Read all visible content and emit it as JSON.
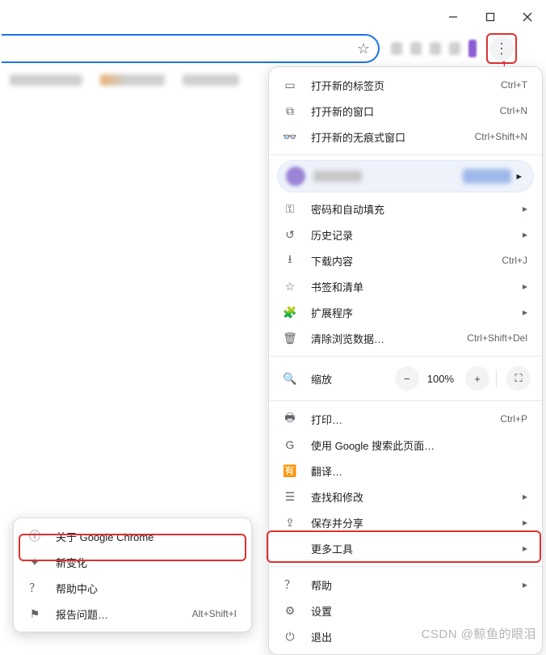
{
  "window_controls": {
    "minimize": "—",
    "maximize": "❐",
    "close": "✕"
  },
  "annotation": {
    "one": "1"
  },
  "menu": {
    "new_tab": {
      "label": "打开新的标签页",
      "shortcut": "Ctrl+T"
    },
    "new_window": {
      "label": "打开新的窗口",
      "shortcut": "Ctrl+N"
    },
    "incognito": {
      "label": "打开新的无痕式窗口",
      "shortcut": "Ctrl+Shift+N"
    },
    "passwords": {
      "label": "密码和自动填充"
    },
    "history": {
      "label": "历史记录"
    },
    "downloads": {
      "label": "下载内容",
      "shortcut": "Ctrl+J"
    },
    "bookmarks": {
      "label": "书签和清单"
    },
    "extensions": {
      "label": "扩展程序"
    },
    "clear_data": {
      "label": "清除浏览数据…",
      "shortcut": "Ctrl+Shift+Del"
    },
    "zoom": {
      "label": "缩放",
      "percent": "100%"
    },
    "print": {
      "label": "打印…",
      "shortcut": "Ctrl+P"
    },
    "google_search": {
      "label": "使用 Google 搜索此页面…"
    },
    "translate": {
      "label": "翻译…"
    },
    "find_edit": {
      "label": "查找和修改"
    },
    "save_share": {
      "label": "保存并分享"
    },
    "more_tools": {
      "label": "更多工具"
    },
    "help": {
      "label": "帮助"
    },
    "settings": {
      "label": "设置"
    },
    "exit": {
      "label": "退出"
    }
  },
  "submenu": {
    "about": {
      "label": "关于 Google Chrome"
    },
    "whats_new": {
      "label": "新变化"
    },
    "help_center": {
      "label": "帮助中心"
    },
    "report": {
      "label": "报告问题…",
      "shortcut": "Alt+Shift+I"
    }
  },
  "watermark": "CSDN @鲸鱼的眼泪"
}
